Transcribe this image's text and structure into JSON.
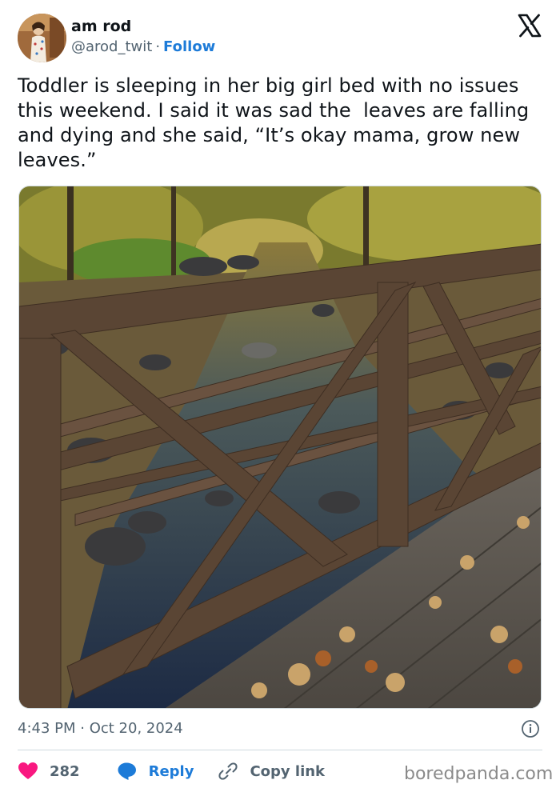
{
  "author": {
    "name": "am rod",
    "handle": "@arod_twit",
    "separator": "·",
    "follow_label": "Follow"
  },
  "tweet": {
    "text": "Toddler is sleeping in her big girl bed with no issues this weekend. I said it was sad the  leaves are falling and dying and she said, “It’s okay mama, grow new leaves.”",
    "timestamp": "4:43 PM · Oct 20, 2024"
  },
  "media": {
    "icon": "photo-image",
    "description_icon": "bridge-over-creek-photo"
  },
  "actions": {
    "like_count": "282",
    "reply_label": "Reply",
    "copy_label": "Copy link"
  },
  "watermark": "boredpanda.com",
  "colors": {
    "link_blue": "#1d7bd8",
    "heart_pink": "#f91880",
    "muted_gray": "#536471",
    "text_dark": "#0f1419"
  }
}
